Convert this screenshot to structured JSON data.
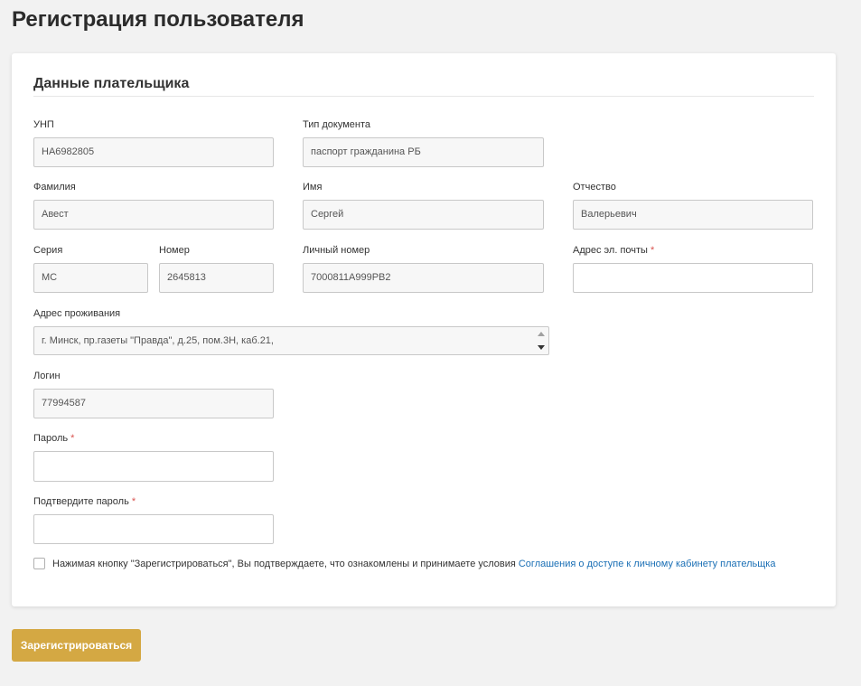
{
  "page_title": "Регистрация пользователя",
  "section_title": "Данные плательщика",
  "fields": {
    "unp": {
      "label": "УНП",
      "value": "НА6982805"
    },
    "doc_type": {
      "label": "Тип документа",
      "value": "паспорт гражданина РБ"
    },
    "last_name": {
      "label": "Фамилия",
      "value": "Авест"
    },
    "first_name": {
      "label": "Имя",
      "value": "Сергей"
    },
    "middle_name": {
      "label": "Отчество",
      "value": "Валерьевич"
    },
    "series": {
      "label": "Серия",
      "value": "МС"
    },
    "number": {
      "label": "Номер",
      "value": "2645813"
    },
    "personal_number": {
      "label": "Личный номер",
      "value": "7000811А999РВ2"
    },
    "email": {
      "label": "Адрес эл. почты",
      "required_mark": "*",
      "value": ""
    },
    "address": {
      "label": "Адрес проживания",
      "value": "г. Минск, пр.газеты \"Правда\", д.25, пом.3Н, каб.21,"
    },
    "login": {
      "label": "Логин",
      "value": "77994587"
    },
    "password": {
      "label": "Пароль",
      "required_mark": "*",
      "value": ""
    },
    "confirm_password": {
      "label": "Подтвердите пароль",
      "required_mark": "*",
      "value": ""
    }
  },
  "agreement": {
    "text": "Нажимая кнопку \"Зарегистрироваться\", Вы подтверждаете, что ознакомлены и принимаете условия",
    "link_text": "Соглашения о доступе к личному кабинету плательщка",
    "checked": false
  },
  "submit_label": "Зарегистрироваться",
  "colors": {
    "accent_button": "#d4a843",
    "link": "#1a6fb5",
    "required": "#d9534f"
  }
}
